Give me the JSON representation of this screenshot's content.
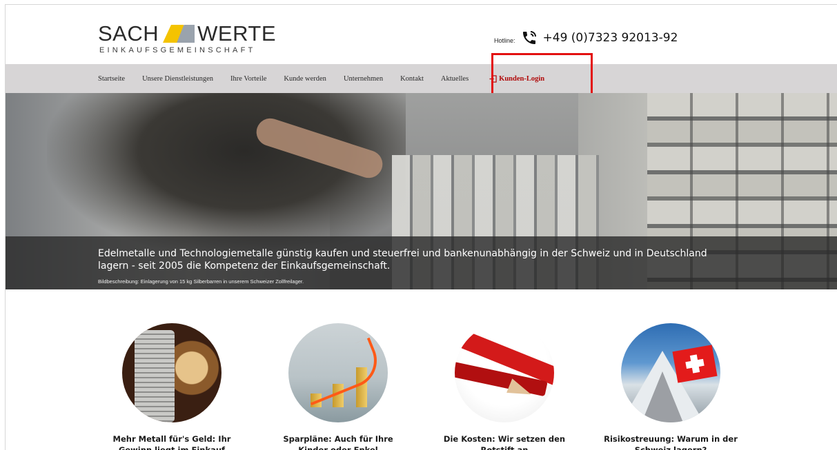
{
  "header": {
    "logo": {
      "word_left": "SACH",
      "word_right": "WERTE",
      "tagline": "EINKAUFSGEMEINSCHAFT"
    },
    "hotline": {
      "label": "Hotline:",
      "number": "+49 (0)7323 92013-92",
      "icon": "phone-icon"
    }
  },
  "nav": {
    "items": [
      {
        "label": "Startseite"
      },
      {
        "label": "Unsere Dienstleistungen"
      },
      {
        "label": "Ihre Vorteile"
      },
      {
        "label": "Kunde werden"
      },
      {
        "label": "Unternehmen"
      },
      {
        "label": "Kontakt"
      },
      {
        "label": "Aktuelles"
      }
    ],
    "login": {
      "label": "Kunden-Login",
      "icon": "login-icon",
      "color": "#b00a0a"
    },
    "background": "#d7d5d6"
  },
  "hero": {
    "caption": "Edelmetalle und Technologiemetalle günstig kaufen und steuerfrei und bankenunabhängig in der Schweiz und in Deutschland lagern - seit 2005 die Kompetenz der Einkaufsgemeinschaft.",
    "image_caption": "Bildbeschreibung: Einlagerung von 15 kg Silberbarren in unserem Schweizer Zollfreilager."
  },
  "features": [
    {
      "line1": "Mehr Metall für's Geld: Ihr",
      "line2": "Gewinn liegt im Einkauf"
    },
    {
      "line1": "Sparpläne: Auch für Ihre",
      "line2": "Kinder oder Enkel"
    },
    {
      "line1": "Die Kosten: Wir setzen den",
      "line2": "Rotstift an"
    },
    {
      "line1": "Risikostreuung: Warum in der",
      "line2": "Schweiz lagern?"
    }
  ],
  "highlight_color": "#e31010"
}
